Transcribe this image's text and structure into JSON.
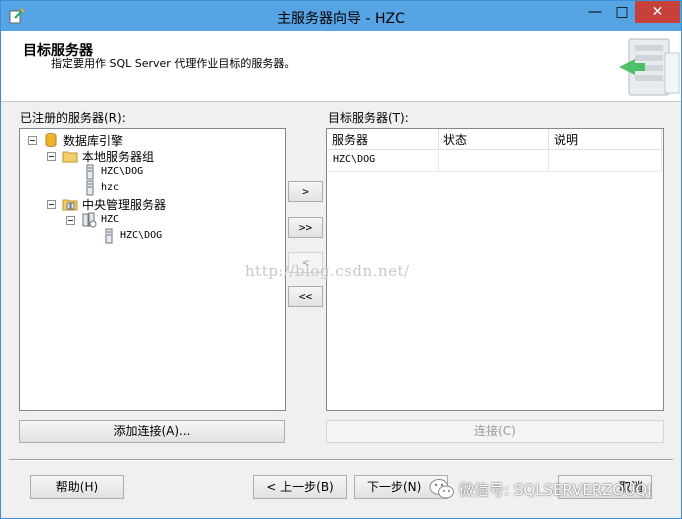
{
  "window": {
    "title": "主服务器向导 - HZC",
    "min": "—",
    "max": "□",
    "close": "✕"
  },
  "header": {
    "title": "目标服务器",
    "subtitle": "指定要用作 SQL Server 代理作业目标的服务器。"
  },
  "left": {
    "label": "已注册的服务器(R):",
    "tree": [
      {
        "label": "数据库引擎",
        "icon": "database-icon"
      },
      {
        "label": "本地服务器组",
        "icon": "folder-icon"
      },
      {
        "label": "HZC\\DOG",
        "icon": "server-icon"
      },
      {
        "label": "hzc",
        "icon": "server-icon"
      },
      {
        "label": "中央管理服务器",
        "icon": "central-management-icon"
      },
      {
        "label": "HZC",
        "icon": "server-group-icon"
      },
      {
        "label": "HZC\\DOG",
        "icon": "server-icon"
      }
    ],
    "add_button": "添加连接(A)..."
  },
  "transfer": {
    "add_one": ">",
    "add_all": ">>",
    "remove_one": "<",
    "remove_all": "<<"
  },
  "right": {
    "label": "目标服务器(T):",
    "columns": [
      "服务器",
      "状态",
      "说明"
    ],
    "rows": [
      {
        "server": "HZC\\DOG",
        "status": "",
        "description": ""
      }
    ],
    "connect_button": "连接(C)"
  },
  "footer": {
    "help": "帮助(H)",
    "back": "< 上一步(B)",
    "next": "下一步(N)",
    "cancel": "取消"
  },
  "overlay": {
    "watermark": "http://blog.csdn.net/",
    "wechat": "微信号: SQLSERVERZOUQI"
  }
}
